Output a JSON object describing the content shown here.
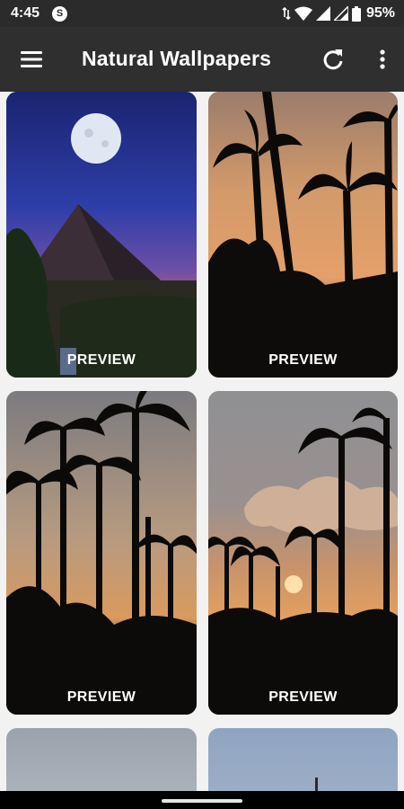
{
  "status_bar": {
    "time": "4:45",
    "app_icon_letter": "S",
    "battery_percent": "95%"
  },
  "app_bar": {
    "title": "Natural Wallpapers",
    "icons": [
      "menu-icon",
      "refresh-icon",
      "more-vert-icon"
    ]
  },
  "grid": {
    "items": [
      {
        "subject": "pyramid-moon",
        "label": "PREVIEW"
      },
      {
        "subject": "palm-sunset-orange",
        "label": "PREVIEW"
      },
      {
        "subject": "palm-grove-dusk",
        "label": "PREVIEW"
      },
      {
        "subject": "palm-sunset-clouds",
        "label": "PREVIEW"
      },
      {
        "subject": "grey-sky"
      },
      {
        "subject": "blue-sky"
      }
    ]
  },
  "colors": {
    "app_bar": "#2f2f2f",
    "status_bar": "#2b2b2b",
    "grid_background": "#f2f2f2"
  }
}
